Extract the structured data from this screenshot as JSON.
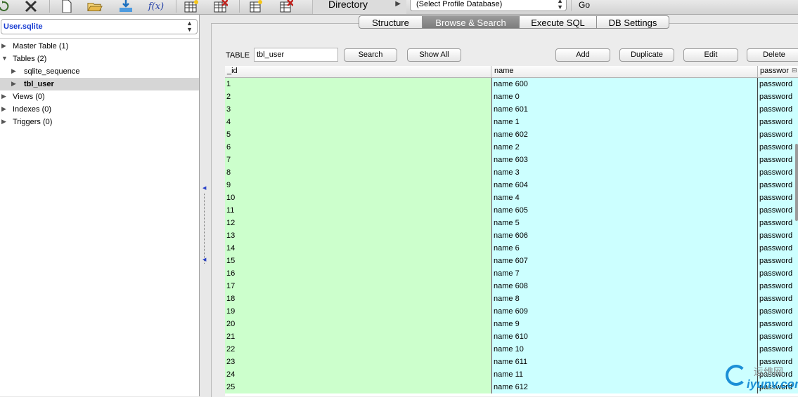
{
  "toolbar": {
    "icons": [
      "refresh-icon",
      "tools-icon",
      "new-file-icon",
      "open-folder-icon",
      "import-icon",
      "function-icon",
      "create-table-icon",
      "delete-table-icon",
      "create-index-icon",
      "delete-index-icon"
    ],
    "function_glyph": "f(x)",
    "directory_label": "Directory",
    "profile_select": "(Select Profile Database)",
    "go_label": "Go"
  },
  "sidebar": {
    "database": "User.sqlite",
    "tree": [
      {
        "label": "Master Table (1)"
      },
      {
        "label": "Tables (2)"
      },
      {
        "label": "sqlite_sequence"
      },
      {
        "label": "tbl_user"
      },
      {
        "label": "Views (0)"
      },
      {
        "label": "Indexes (0)"
      },
      {
        "label": "Triggers (0)"
      }
    ]
  },
  "tabs": [
    "Structure",
    "Browse & Search",
    "Execute SQL",
    "DB Settings"
  ],
  "active_tab": "Browse & Search",
  "browse": {
    "table_label": "TABLE",
    "table_value": "tbl_user",
    "search_button": "Search",
    "show_all_button": "Show All",
    "add_button": "Add",
    "duplicate_button": "Duplicate",
    "edit_button": "Edit",
    "delete_button": "Delete"
  },
  "grid": {
    "columns": [
      "_id",
      "name",
      "passwor"
    ],
    "rows": [
      [
        "1",
        "name 600",
        "password"
      ],
      [
        "2",
        "name 0",
        "password"
      ],
      [
        "3",
        "name 601",
        "password"
      ],
      [
        "4",
        "name 1",
        "password"
      ],
      [
        "5",
        "name 602",
        "password"
      ],
      [
        "6",
        "name 2",
        "password"
      ],
      [
        "7",
        "name 603",
        "password"
      ],
      [
        "8",
        "name 3",
        "password"
      ],
      [
        "9",
        "name 604",
        "password"
      ],
      [
        "10",
        "name 4",
        "password"
      ],
      [
        "11",
        "name 605",
        "password"
      ],
      [
        "12",
        "name 5",
        "password"
      ],
      [
        "13",
        "name 606",
        "password"
      ],
      [
        "14",
        "name 6",
        "password"
      ],
      [
        "15",
        "name 607",
        "password"
      ],
      [
        "16",
        "name 7",
        "password"
      ],
      [
        "17",
        "name 608",
        "password"
      ],
      [
        "18",
        "name 8",
        "password"
      ],
      [
        "19",
        "name 609",
        "password"
      ],
      [
        "20",
        "name 9",
        "password"
      ],
      [
        "21",
        "name 610",
        "password"
      ],
      [
        "22",
        "name 10",
        "password"
      ],
      [
        "23",
        "name 611",
        "password"
      ],
      [
        "24",
        "name 11",
        "password"
      ],
      [
        "25",
        "name 612",
        "password"
      ]
    ]
  },
  "watermark": {
    "line1": "运维网",
    "line2": "iyunv.com"
  }
}
